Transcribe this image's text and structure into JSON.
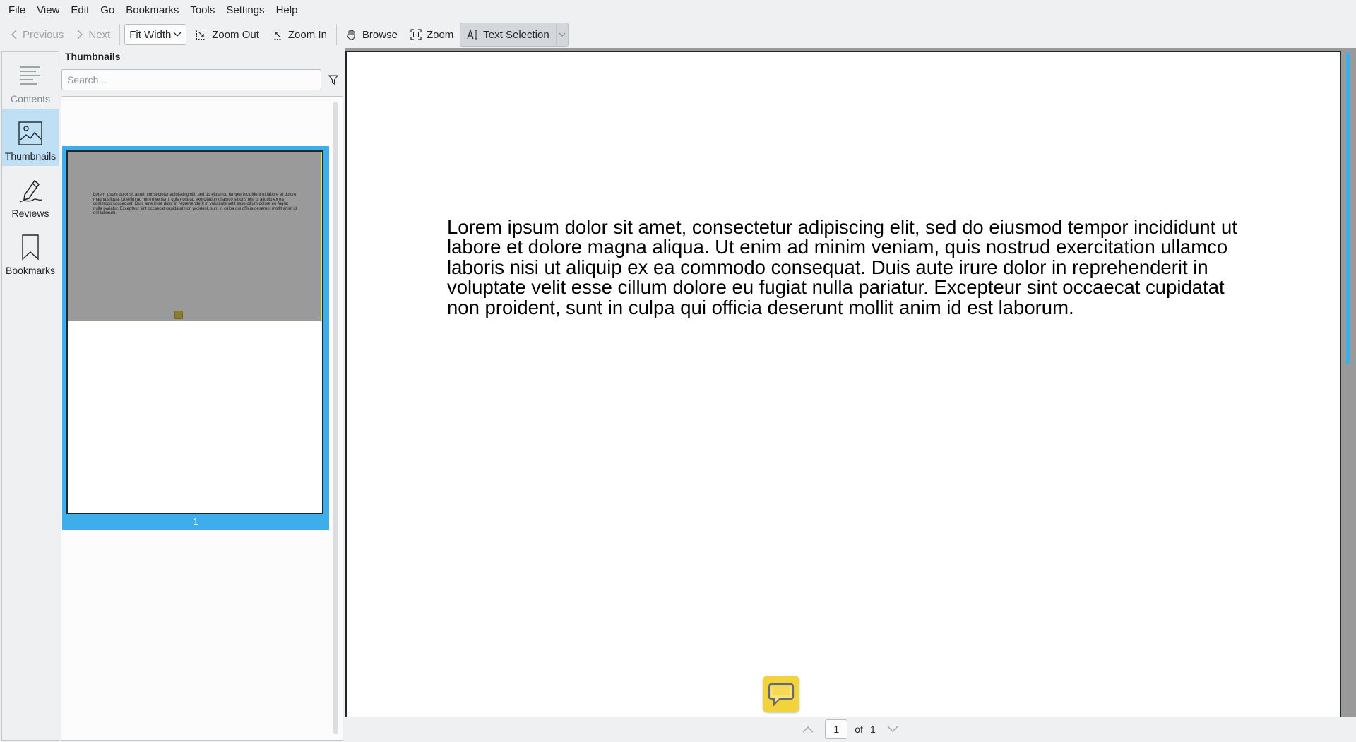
{
  "menu": [
    "File",
    "View",
    "Edit",
    "Go",
    "Bookmarks",
    "Tools",
    "Settings",
    "Help"
  ],
  "toolbar": {
    "previous": "Previous",
    "next": "Next",
    "zoom_mode": "Fit Width",
    "zoom_out": "Zoom Out",
    "zoom_in": "Zoom In",
    "browse": "Browse",
    "zoom": "Zoom",
    "text_selection": "Text Selection"
  },
  "sidebar": {
    "tabs": [
      {
        "label": "Contents",
        "icon": "contents-icon",
        "state": "disabled"
      },
      {
        "label": "Thumbnails",
        "icon": "thumbnails-icon",
        "state": "active"
      },
      {
        "label": "Reviews",
        "icon": "pen-icon",
        "state": "normal"
      },
      {
        "label": "Bookmarks",
        "icon": "bookmark-icon",
        "state": "normal"
      }
    ]
  },
  "panel": {
    "title": "Thumbnails",
    "search_placeholder": "Search...",
    "thumbnail_page_number": "1"
  },
  "document": {
    "text": "Lorem ipsum dolor sit amet, consectetur adipiscing elit, sed do eiusmod tempor incididunt ut labore et dolore magna aliqua. Ut enim ad minim veniam, quis nostrud exercitation ullamco laboris nisi ut aliquip ex ea commodo consequat. Duis aute irure dolor in reprehenderit in voluptate velit esse cillum dolore eu fugiat nulla pariatur. Excepteur sint occaecat cupidatat non proident, sunt in culpa qui officia deserunt mollit anim id est laborum."
  },
  "pagebar": {
    "current_page": "1",
    "of_label": "of",
    "total_pages": "1"
  },
  "colors": {
    "accent": "#3daee9",
    "note_yellow": "#f2d33a",
    "window_bg": "#eff0f1"
  }
}
